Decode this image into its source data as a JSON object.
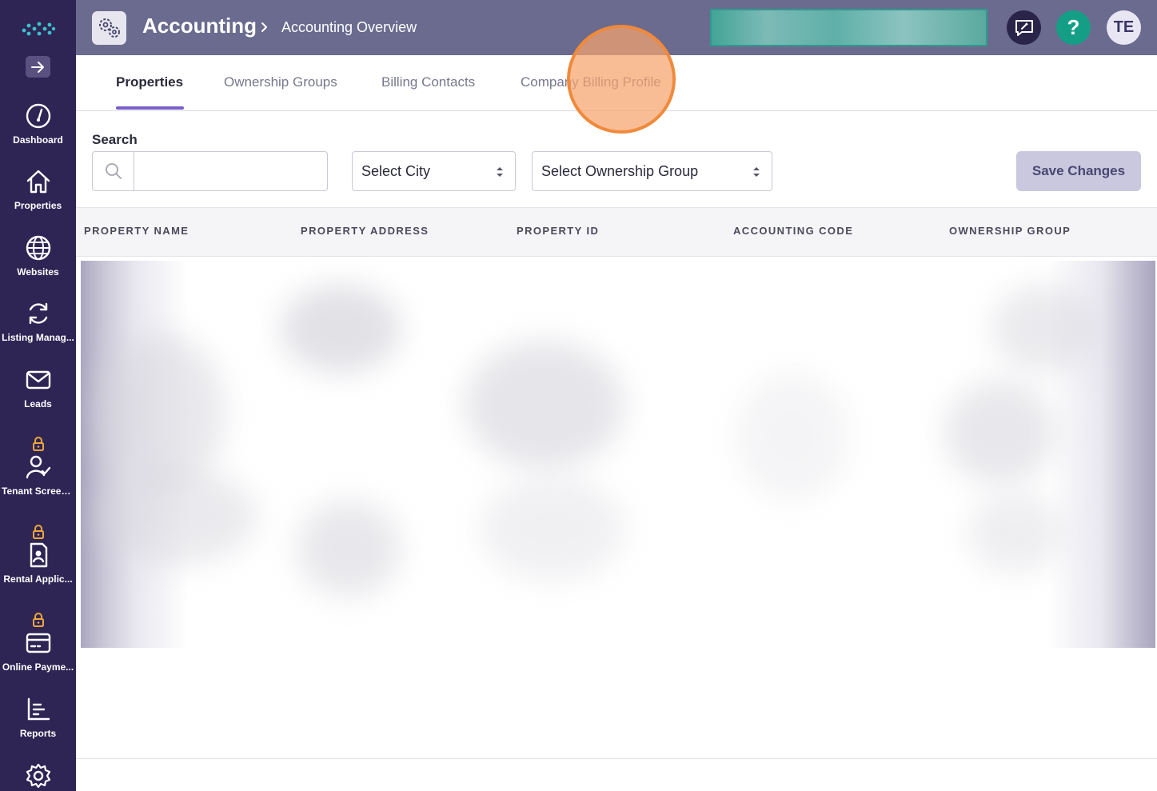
{
  "sidebar": {
    "items": [
      {
        "label": "Dashboard",
        "icon": "dashboard-gauge-icon",
        "locked": false
      },
      {
        "label": "Properties",
        "icon": "home-icon",
        "locked": false
      },
      {
        "label": "Websites",
        "icon": "globe-icon",
        "locked": false
      },
      {
        "label": "Listing Manag...",
        "icon": "sync-icon",
        "locked": false
      },
      {
        "label": "Leads",
        "icon": "envelope-icon",
        "locked": false
      },
      {
        "label": "Tenant Screen...",
        "icon": "user-check-icon",
        "locked": true
      },
      {
        "label": "Rental Applic...",
        "icon": "document-user-icon",
        "locked": true
      },
      {
        "label": "Online Payme...",
        "icon": "credit-card-icon",
        "locked": true
      },
      {
        "label": "Reports",
        "icon": "bar-chart-icon",
        "locked": false
      },
      {
        "label": "",
        "icon": "gear-icon",
        "locked": false
      }
    ]
  },
  "header": {
    "title": "Accounting",
    "breadcrumb_current": "Accounting Overview",
    "avatar_initials": "TE",
    "help_glyph": "?"
  },
  "tabs": [
    {
      "label": "Properties",
      "active": true
    },
    {
      "label": "Ownership Groups",
      "active": false
    },
    {
      "label": "Billing Contacts",
      "active": false
    },
    {
      "label": "Company Billing Profile",
      "active": false
    }
  ],
  "filters": {
    "search_label": "Search",
    "search_value": "",
    "city_select": "Select City",
    "ownership_select": "Select Ownership Group",
    "save_label": "Save Changes"
  },
  "table": {
    "columns": [
      "PROPERTY NAME",
      "PROPERTY ADDRESS",
      "PROPERTY ID",
      "ACCOUNTING CODE",
      "OWNERSHIP GROUP"
    ]
  },
  "colors": {
    "sidebar_bg": "#2e2555",
    "header_bg": "#6a6b8f",
    "accent": "#7b5fc9",
    "help_green": "#159e86",
    "lock_orange": "#f0a63a"
  }
}
